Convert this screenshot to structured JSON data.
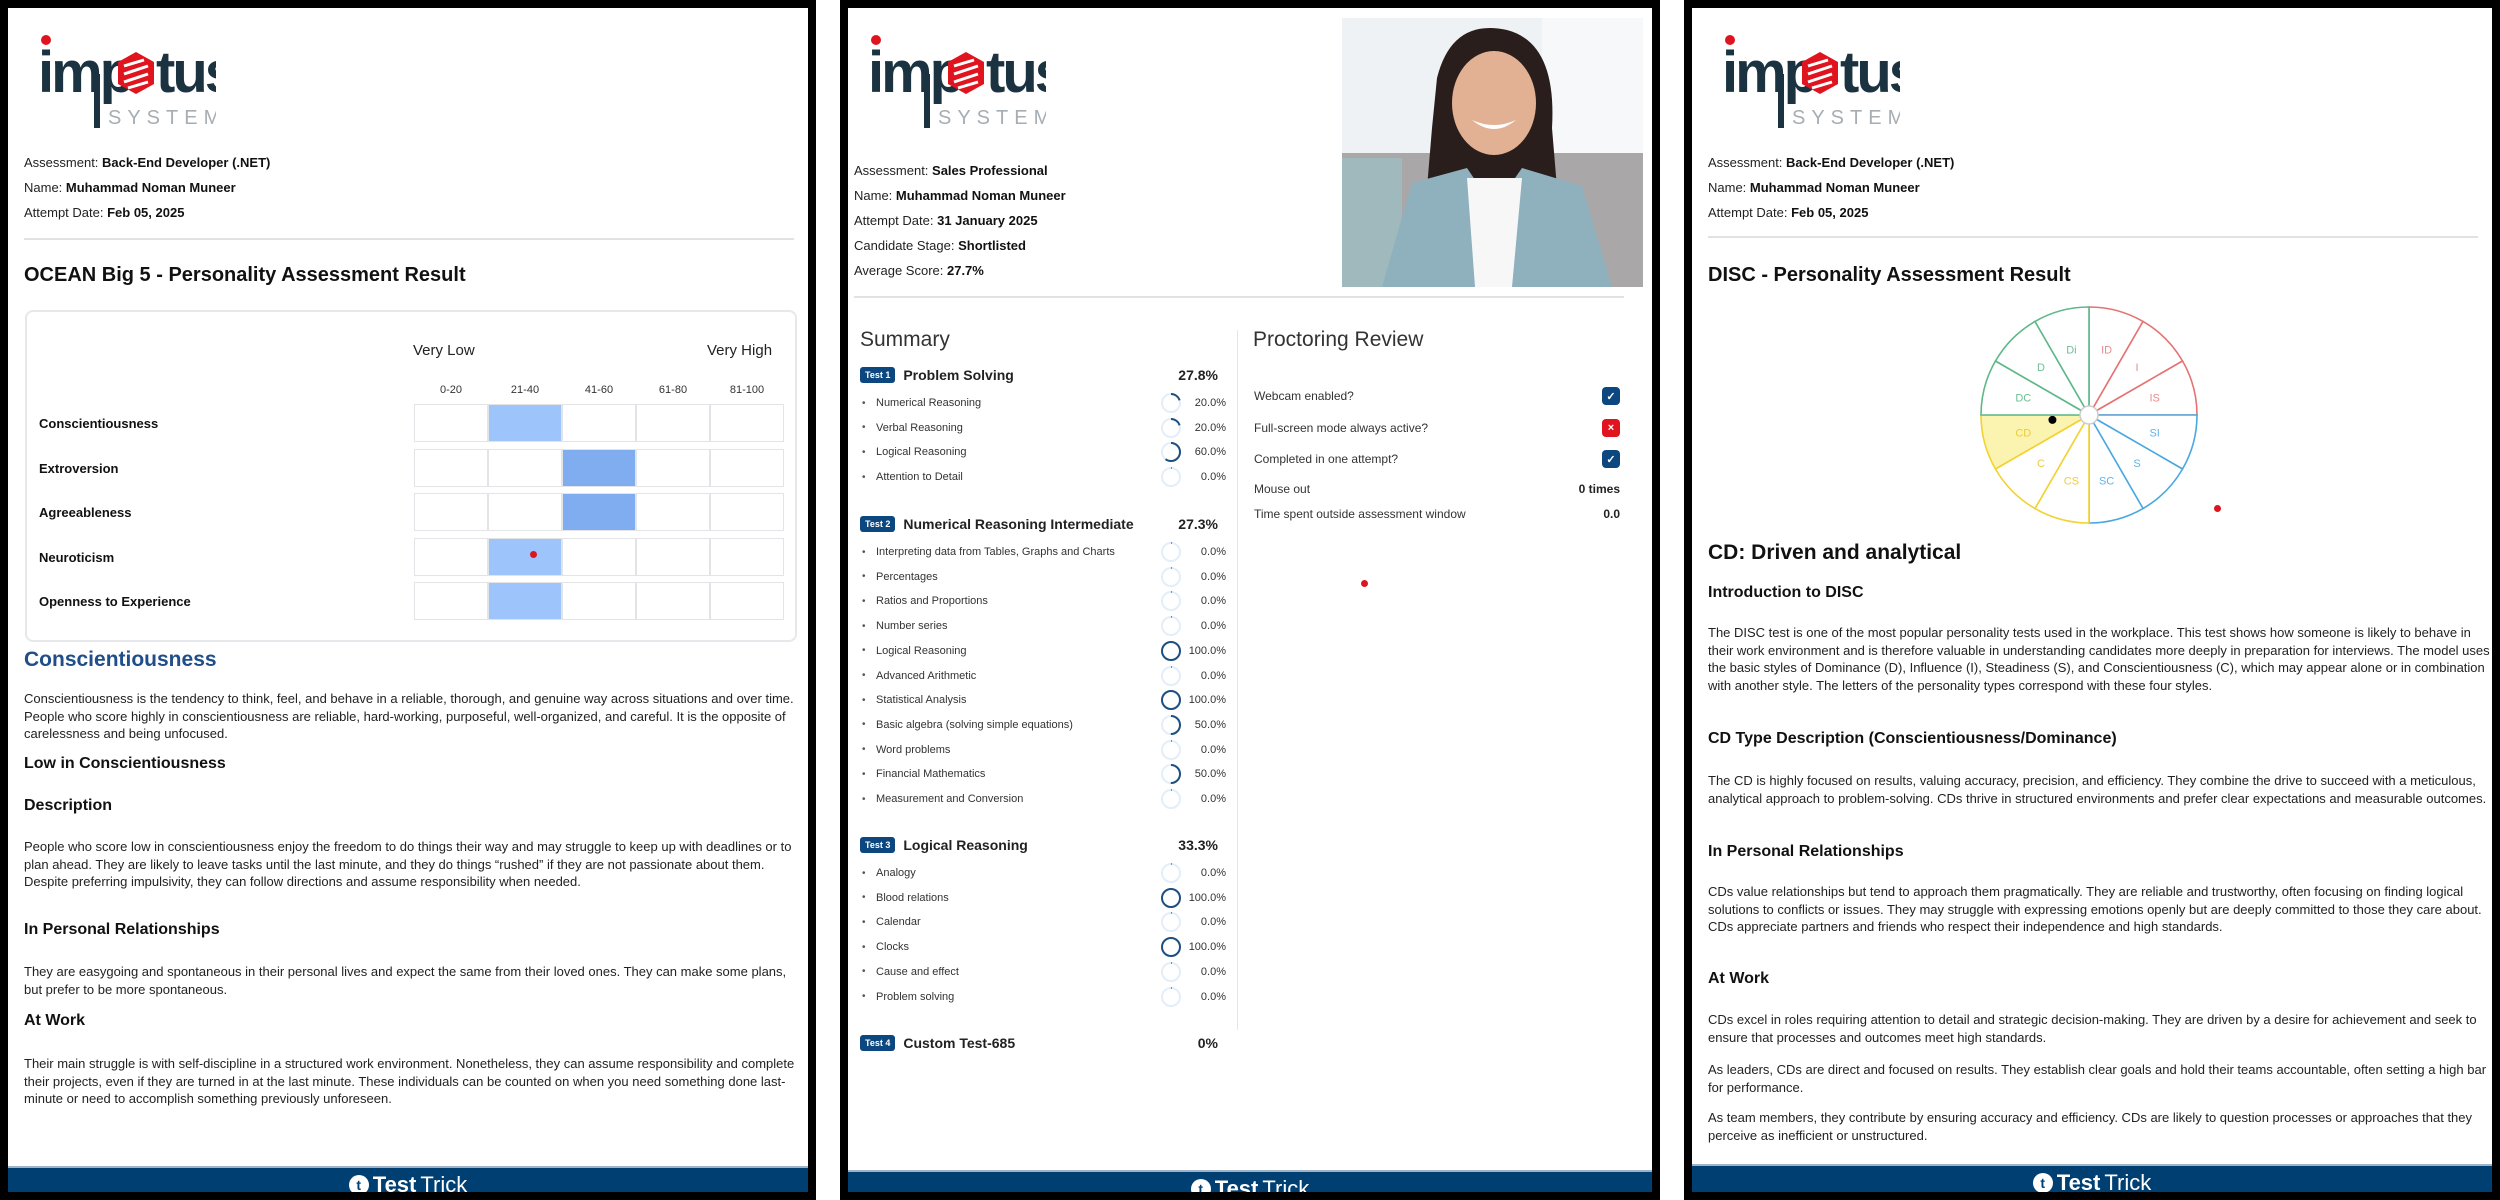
{
  "footer": {
    "brand_bold": "Test",
    "brand_light": "Trick",
    "icon": "testtrick-logo-icon"
  },
  "logo": {
    "word": "impetus",
    "sub": "SYSTEMS"
  },
  "panel1": {
    "meta": [
      {
        "label": "Assessment: ",
        "value": "Back-End Developer (.NET)"
      },
      {
        "label": "Name: ",
        "value": "Muhammad Noman Muneer"
      },
      {
        "label": "Attempt Date: ",
        "value": "Feb 05, 2025"
      }
    ],
    "title": "OCEAN Big 5 - Personality Assessment Result",
    "chart_data": {
      "type": "heatmap",
      "title": "OCEAN Big 5 - Personality Assessment Result",
      "scale_low": "Very Low",
      "scale_high": "Very High",
      "ranges": [
        "0-20",
        "21-40",
        "41-60",
        "61-80",
        "81-100"
      ],
      "traits": [
        {
          "name": "Conscientiousness",
          "range_index": 1,
          "range": "21-40"
        },
        {
          "name": "Extroversion",
          "range_index": 2,
          "range": "41-60"
        },
        {
          "name": "Agreeableness",
          "range_index": 2,
          "range": "41-60"
        },
        {
          "name": "Neuroticism",
          "range_index": 1,
          "range": "21-40"
        },
        {
          "name": "Openness to Experience",
          "range_index": 1,
          "range": "21-40"
        }
      ]
    },
    "section_title": "Conscientiousness",
    "intro": "Conscientiousness is the tendency to think, feel, and behave in a reliable, thorough, and genuine way across situations and over time. People who score highly in conscientiousness are reliable, hard-working, purposeful, well-organized, and careful. It is the opposite of carelessness and being unfocused.",
    "level_heading": "Low in Conscientiousness",
    "desc_heading": "Description",
    "desc": "People who score low in conscientiousness enjoy the freedom to do things their way and may struggle to keep up with deadlines or to plan ahead. They are likely to leave tasks until the last minute, and they do things “rushed” if they are not passionate about them. Despite preferring impulsivity, they can follow directions and assume responsibility when needed.",
    "rel_heading": "In Personal Relationships",
    "rel": "They are easygoing and spontaneous in their personal lives and expect the same from their loved ones. They can make some plans, but prefer to be more spontaneous.",
    "work_heading": "At Work",
    "work": "Their main struggle is with self-discipline in a structured work environment. Nonetheless, they can assume responsibility and complete their projects, even if they are turned in at the last minute. These individuals can be counted on when you need something done last-minute or need to accomplish something previously unforeseen."
  },
  "panel2": {
    "meta": [
      {
        "label": "Assessment: ",
        "value": "Sales Professional"
      },
      {
        "label": "Name: ",
        "value": "Muhammad Noman Muneer"
      },
      {
        "label": "Attempt Date: ",
        "value": "31 January 2025"
      },
      {
        "label": "Candidate Stage: ",
        "value": "Shortlisted"
      },
      {
        "label": "Average Score: ",
        "value": "27.7%"
      }
    ],
    "summary_title": "Summary",
    "proctoring_title": "Proctoring Review",
    "tests": [
      {
        "badge": "Test 1",
        "name": "Problem Solving",
        "score": "27.8%",
        "items": [
          {
            "name": "Numerical Reasoning",
            "value": "20.0%",
            "pct": 20
          },
          {
            "name": "Verbal Reasoning",
            "value": "20.0%",
            "pct": 20
          },
          {
            "name": "Logical Reasoning",
            "value": "60.0%",
            "pct": 60
          },
          {
            "name": "Attention to Detail",
            "value": "0.0%",
            "pct": 0
          }
        ]
      },
      {
        "badge": "Test 2",
        "name": "Numerical Reasoning Intermediate",
        "score": "27.3%",
        "items": [
          {
            "name": "Interpreting data from Tables, Graphs and Charts",
            "value": "0.0%",
            "pct": 0
          },
          {
            "name": "Percentages",
            "value": "0.0%",
            "pct": 0
          },
          {
            "name": "Ratios and Proportions",
            "value": "0.0%",
            "pct": 0
          },
          {
            "name": "Number series",
            "value": "0.0%",
            "pct": 0
          },
          {
            "name": "Logical Reasoning",
            "value": "100.0%",
            "pct": 100
          },
          {
            "name": "Advanced Arithmetic",
            "value": "0.0%",
            "pct": 0
          },
          {
            "name": "Statistical Analysis",
            "value": "100.0%",
            "pct": 100
          },
          {
            "name": "Basic algebra (solving simple equations)",
            "value": "50.0%",
            "pct": 50
          },
          {
            "name": "Word problems",
            "value": "0.0%",
            "pct": 0
          },
          {
            "name": "Financial Mathematics",
            "value": "50.0%",
            "pct": 50
          },
          {
            "name": "Measurement and Conversion",
            "value": "0.0%",
            "pct": 0
          }
        ]
      },
      {
        "badge": "Test 3",
        "name": "Logical Reasoning",
        "score": "33.3%",
        "items": [
          {
            "name": "Analogy",
            "value": "0.0%",
            "pct": 0
          },
          {
            "name": "Blood relations",
            "value": "100.0%",
            "pct": 100
          },
          {
            "name": "Calendar",
            "value": "0.0%",
            "pct": 0
          },
          {
            "name": "Clocks",
            "value": "100.0%",
            "pct": 100
          },
          {
            "name": "Cause and effect",
            "value": "0.0%",
            "pct": 0
          },
          {
            "name": "Problem solving",
            "value": "0.0%",
            "pct": 0
          }
        ]
      },
      {
        "badge": "Test 4",
        "name": "Custom Test-685",
        "score": "0%",
        "items": []
      }
    ],
    "proctoring": [
      {
        "label": "Webcam enabled?",
        "type": "check",
        "state": "yes",
        "icon": "check-icon"
      },
      {
        "label": "Full-screen mode always active?",
        "type": "check",
        "state": "no",
        "icon": "x-icon"
      },
      {
        "label": "Completed in one attempt?",
        "type": "check",
        "state": "yes",
        "icon": "check-icon"
      },
      {
        "label": "Mouse out",
        "type": "value",
        "value": "0 times"
      },
      {
        "label": "Time spent outside assessment window",
        "type": "value",
        "value": "0.0"
      }
    ],
    "glyphs": {
      "check": "✓",
      "cross": "×",
      "bullet": "•"
    }
  },
  "panel3": {
    "meta": [
      {
        "label": "Assessment: ",
        "value": "Back-End Developer (.NET)"
      },
      {
        "label": "Name: ",
        "value": "Muhammad Noman Muneer"
      },
      {
        "label": "Attempt Date: ",
        "value": "Feb 05, 2025"
      }
    ],
    "title": "DISC - Personality Assessment Result",
    "disc_wheel": {
      "segments": [
        {
          "label": "ID",
          "group": "I"
        },
        {
          "label": "I",
          "group": "I"
        },
        {
          "label": "IS",
          "group": "I"
        },
        {
          "label": "SI",
          "group": "S"
        },
        {
          "label": "S",
          "group": "S"
        },
        {
          "label": "SC",
          "group": "S"
        },
        {
          "label": "CS",
          "group": "C"
        },
        {
          "label": "C",
          "group": "C"
        },
        {
          "label": "CD",
          "group": "C"
        },
        {
          "label": "DC",
          "group": "D"
        },
        {
          "label": "D",
          "group": "D"
        },
        {
          "label": "Di",
          "group": "D"
        }
      ],
      "highlighted": "CD",
      "colors": {
        "I": "#e57373",
        "S": "#4aa8e0",
        "C": "#f2d230",
        "D": "#5db88a",
        "highlight_fill": "#fbf4b0",
        "label_I": "#e98a8a",
        "label_S": "#5fb3e6",
        "label_C": "#eecb3a",
        "label_D": "#6dbf95"
      }
    },
    "type_title": "CD: Driven and analytical",
    "intro_heading": "Introduction to DISC",
    "intro": "The DISC test is one of the most popular personality tests used in the workplace. This test shows how someone is likely to behave in their work environment and is therefore valuable in understanding candidates more deeply in preparation for interviews. The model uses the basic styles of Dominance (D), Influence (I), Steadiness (S), and Conscientiousness (C), which may appear alone or in combination with another style. The letters of the personality types correspond with these four styles.",
    "type_heading": "CD Type Description (Conscientiousness/Dominance)",
    "type_desc": "The CD is highly focused on results, valuing accuracy, precision, and efficiency. They combine the drive to succeed with a meticulous, analytical approach to problem-solving. CDs thrive in structured environments and prefer clear expectations and measurable outcomes.",
    "rel_heading": "In Personal Relationships",
    "rel": "CDs value relationships but tend to approach them pragmatically. They are reliable and trustworthy, often focusing on finding logical solutions to conflicts or issues. They may struggle with expressing emotions openly but are deeply committed to those they care about. CDs appreciate partners and friends who respect their independence and high standards.",
    "work_heading": "At Work",
    "work1": "CDs excel in roles requiring attention to detail and strategic decision-making. They are driven by a desire for achievement and seek to ensure that processes and outcomes meet high standards.",
    "work2": "As leaders, CDs are direct and focused on results. They establish clear goals and hold their teams accountable, often setting a high bar for performance.",
    "work3": "As team members, they contribute by ensuring accuracy and efficiency. CDs are likely to question processes or approaches that they perceive as inefficient or unstructured."
  }
}
